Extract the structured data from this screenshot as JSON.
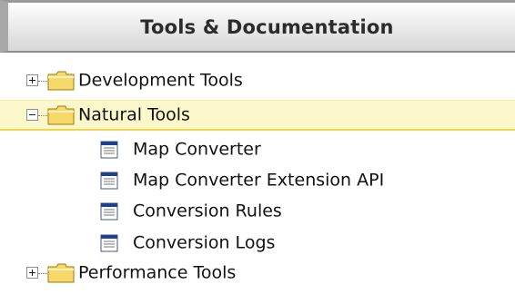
{
  "panel": {
    "title": "Tools & Documentation"
  },
  "tree": {
    "items": [
      {
        "label": "Development Tools",
        "type": "folder",
        "expanded": false
      },
      {
        "label": "Natural Tools",
        "type": "folder",
        "expanded": true,
        "selected": true
      },
      {
        "label": "Map Converter",
        "type": "document"
      },
      {
        "label": "Map Converter Extension API",
        "type": "document"
      },
      {
        "label": "Conversion Rules",
        "type": "document"
      },
      {
        "label": "Conversion Logs",
        "type": "document"
      },
      {
        "label": "Performance Tools",
        "type": "folder",
        "expanded": false
      }
    ]
  },
  "icons": {
    "expand": "plus-box-icon",
    "collapse": "minus-box-icon",
    "folder": "folder-icon",
    "document": "document-icon"
  },
  "colors": {
    "selected_background": "#fdf8cc",
    "selected_border": "#f1d54a",
    "folder_fill": "#f7d96b",
    "document_header": "#1f3f8f"
  }
}
